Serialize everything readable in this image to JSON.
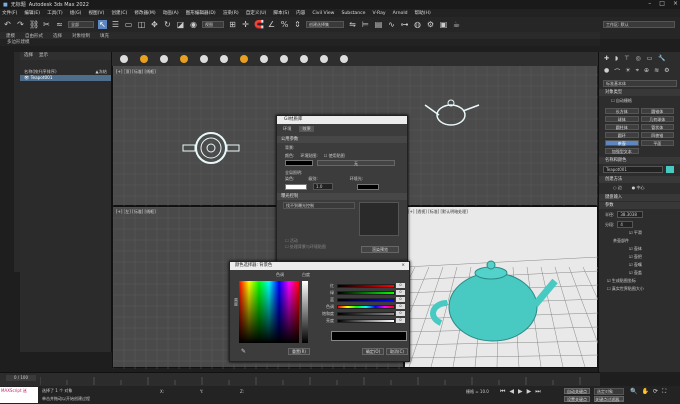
{
  "title": {
    "doc": "无标题",
    "app": "Autodesk 3ds Max 2022"
  },
  "menu": [
    "文件(F)",
    "编辑(E)",
    "工具(T)",
    "组(G)",
    "视图(V)",
    "创建(C)",
    "修改器(M)",
    "动画(A)",
    "图形编辑器(D)",
    "渲染(R)",
    "自定义(U)",
    "脚本(S)",
    "内容",
    "Civil View",
    "Substance",
    "V-Ray",
    "Arnold",
    "帮助(H)"
  ],
  "toolbar": {
    "filter": "全部",
    "view": "视图",
    "selset": "创建选择集",
    "workspace": "工作区: 默认"
  },
  "ribbon": [
    "建模",
    "自由形式",
    "选择",
    "对象绘制",
    "填充"
  ],
  "ribbon_sub": "多边形建模",
  "scene": {
    "tabs": [
      "选择",
      "显示"
    ],
    "items": [
      "名称(按升序排序)",
      "Teapot001"
    ],
    "header_right": "▲冻结"
  },
  "viewports": {
    "top": "[+] [顶] [标准] [线框]",
    "bl": "[+] [左] [标准] [线框]",
    "br": "[+] [透视] [标准] [默认明暗处理]"
  },
  "right": {
    "section": "标准基本体",
    "obj_type": "对象类型",
    "auto_grid": "自动栅格",
    "buttons": [
      "长方体",
      "圆锥体",
      "球体",
      "几何球体",
      "圆柱体",
      "管状体",
      "圆环",
      "四棱锥",
      "茶壶",
      "平面",
      "加强型文本"
    ],
    "name_color": "名称和颜色",
    "name": "Teapot001",
    "create_method": "创建方法",
    "edge": "边",
    "center": "中心",
    "keyboard": "键盘输入",
    "params": "参数",
    "radius_label": "半径:",
    "radius": "38.3038",
    "segments_label": "分段:",
    "segments": "4",
    "smooth": "平滑",
    "parts": "茶壶部件",
    "parts_list": [
      "壶体",
      "壶把",
      "壶嘴",
      "壶盖"
    ],
    "uv": "生成贴图坐标",
    "realworld": "真实世界贴图大小"
  },
  "mtl_dialog": {
    "title": "GI材质库",
    "tabs": [
      "环境",
      "效果"
    ],
    "common": "公用参数",
    "bg": "背景:",
    "color": "颜色:",
    "env_map": "环境贴图:",
    "use_map": "使用贴图",
    "none": "无",
    "global": "全局照明:",
    "tint": "染色:",
    "level": "级别:",
    "level_val": "1.0",
    "ambient": "环境光:",
    "exposure": "曝光控制",
    "exposure_sel": "找不到曝光控制",
    "active": "活动",
    "process_bg": "处理背景与环境贴图",
    "render_preview": "渲染预览"
  },
  "color_picker": {
    "title": "颜色选择器: 背景色",
    "hue": "色调",
    "white": "白度",
    "black": "黑度",
    "labels": [
      "红",
      "绿",
      "蓝",
      "色调",
      "饱和度",
      "亮度"
    ],
    "values": [
      "0",
      "0",
      "0",
      "0",
      "0",
      "0"
    ],
    "reset": "重置(R)",
    "ok": "确定(O)",
    "cancel": "取消(C)"
  },
  "timeline": {
    "frame": "0 / 100"
  },
  "status": {
    "script": "MAXScript 迷",
    "sel": "选择了 1 个 对象",
    "hint": "单击并拖动以开始创建过程",
    "x": "X:",
    "y": "Y:",
    "z": "Z:",
    "grid": "栅格 = 10.0",
    "autokey": "自动关键点",
    "setkey": "设置关键点",
    "filter": "选定对象",
    "keyfilter": "关键点过滤器..."
  },
  "colors": {
    "teapot": "#48c9c2",
    "accent": "#5b88c2",
    "bg_black": "#000000"
  }
}
